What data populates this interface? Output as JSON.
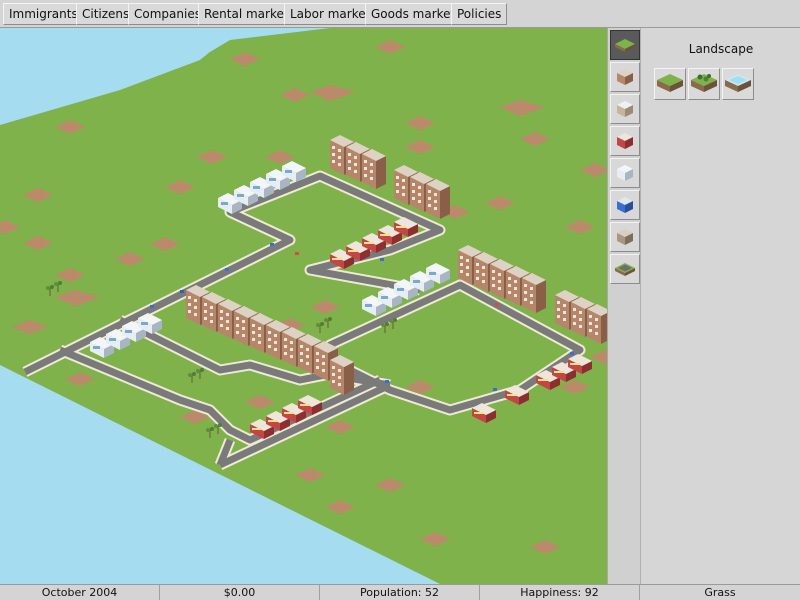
{
  "menu": {
    "immigrants": "Immigrants",
    "citizens": "Citizens",
    "companies": "Companies",
    "rental_market": "Rental market",
    "labor_market": "Labor market",
    "goods_market": "Goods market",
    "policies": "Policies"
  },
  "tools": [
    {
      "icon": "landscape-icon",
      "selected": true
    },
    {
      "icon": "residential-building-icon"
    },
    {
      "icon": "office-building-icon"
    },
    {
      "icon": "shop-building-icon"
    },
    {
      "icon": "commercial-building-icon"
    },
    {
      "icon": "service-building-icon"
    },
    {
      "icon": "warehouse-building-icon"
    },
    {
      "icon": "road-icon"
    }
  ],
  "panel": {
    "title": "Landscape",
    "tiles": [
      {
        "icon": "grass-tile-icon"
      },
      {
        "icon": "trees-tile-icon"
      },
      {
        "icon": "water-tile-icon"
      }
    ]
  },
  "status": {
    "date": "October 2004",
    "money": "$0.00",
    "population": "Population: 52",
    "happiness": "Happiness: 92",
    "selected_tile": "Grass"
  },
  "colors": {
    "grass": "#7fb24a",
    "water": "#9fd8ee",
    "dirt": "#bb8a6a",
    "road": "#7a7a7a"
  }
}
